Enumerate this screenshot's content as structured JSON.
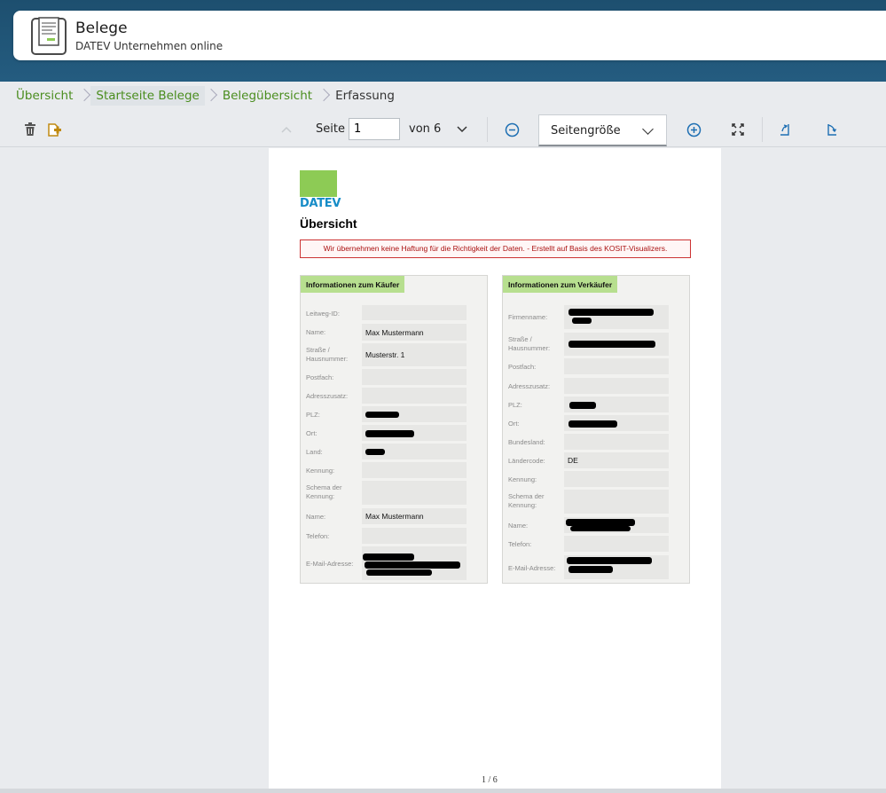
{
  "header": {
    "title": "Belege",
    "subtitle": "DATEV Unternehmen online"
  },
  "breadcrumb": {
    "items": [
      {
        "label": "Übersicht"
      },
      {
        "label": "Startseite Belege"
      },
      {
        "label": "Belegübersicht"
      },
      {
        "label": "Erfassung"
      }
    ]
  },
  "toolbar": {
    "seite_label": "Seite",
    "page_value": "1",
    "von_label": "von 6",
    "zoom_selected": "Seitengröße"
  },
  "document": {
    "logo_text": "DATEV",
    "heading": "Übersicht",
    "disclaimer": "Wir übernehmen keine Haftung für die Richtigkeit der Daten. - Erstellt auf Basis des KOSIT-Visualizers.",
    "buyer": {
      "title": "Informationen zum Käufer",
      "fields": [
        {
          "label": "Leitweg-ID:",
          "value": ""
        },
        {
          "label": "Name:",
          "value": "Max Mustermann"
        },
        {
          "label": "Straße / Hausnummer:",
          "value": "Musterstr. 1"
        },
        {
          "label": "Postfach:",
          "value": ""
        },
        {
          "label": "Adresszusatz:",
          "value": ""
        },
        {
          "label": "PLZ:",
          "value": ""
        },
        {
          "label": "Ort:",
          "value": ""
        },
        {
          "label": "Land:",
          "value": ""
        },
        {
          "label": "Kennung:",
          "value": ""
        },
        {
          "label": "Schema der Kennung:",
          "value": ""
        },
        {
          "label": "Name:",
          "value": "Max Mustermann"
        },
        {
          "label": "Telefon:",
          "value": ""
        },
        {
          "label": "E-Mail-Adresse:",
          "value": ""
        }
      ]
    },
    "seller": {
      "title": "Informationen zum Verkäufer",
      "fields": [
        {
          "label": "Firmenname:",
          "value": ""
        },
        {
          "label": "Straße / Hausnummer:",
          "value": ""
        },
        {
          "label": "Postfach:",
          "value": ""
        },
        {
          "label": "Adresszusatz:",
          "value": ""
        },
        {
          "label": "PLZ:",
          "value": ""
        },
        {
          "label": "Ort:",
          "value": ""
        },
        {
          "label": "Bundesland:",
          "value": ""
        },
        {
          "label": "Ländercode:",
          "value": "DE"
        },
        {
          "label": "Kennung:",
          "value": ""
        },
        {
          "label": "Schema der Kennung:",
          "value": ""
        },
        {
          "label": "Name:",
          "value": ""
        },
        {
          "label": "Telefon:",
          "value": ""
        },
        {
          "label": "E-Mail-Adresse:",
          "value": ""
        }
      ]
    },
    "page_counter": "1 / 6"
  },
  "colors": {
    "header_bg": "#245c80",
    "link_green": "#4a8d1e",
    "datev_green": "#8dcb55",
    "datev_blue": "#168cc7",
    "panel_head": "#b7df8f"
  },
  "icons": [
    "receipt-icon",
    "trash-icon",
    "add-document-icon",
    "chevron-up-icon",
    "chevron-down-icon",
    "zoom-out-icon",
    "zoom-in-icon",
    "fullscreen-icon",
    "rotate-left-icon",
    "rotate-right-icon"
  ]
}
